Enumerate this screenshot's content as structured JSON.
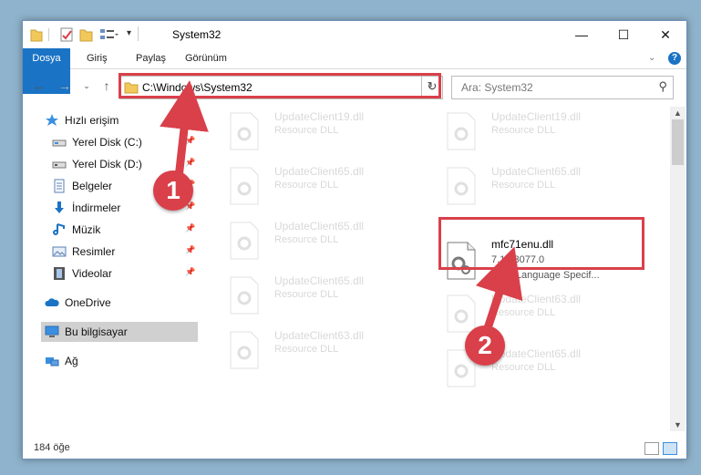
{
  "window": {
    "title": "System32",
    "controls": {
      "minimize": "—",
      "maximize": "☐",
      "close": "✕"
    }
  },
  "ribbon": {
    "tabs": [
      "Dosya",
      "Giriş",
      "Paylaş",
      "Görünüm"
    ]
  },
  "navbar": {
    "address": "C:\\Windows\\System32",
    "search_placeholder": "Ara: System32"
  },
  "sidebar": {
    "quick_access": "Hızlı erişim",
    "items": [
      "Yerel Disk (C:)",
      "Yerel Disk (D:)",
      "Belgeler",
      "İndirmeler",
      "Müzik",
      "Resimler",
      "Videolar"
    ],
    "onedrive": "OneDrive",
    "this_pc": "Bu bilgisayar",
    "network": "Ağ"
  },
  "files": {
    "left": [
      {
        "name": "UpdateClient19.dll",
        "desc": "Resource DLL"
      },
      {
        "name": "UpdateClient65.dll",
        "desc": "Resource DLL"
      },
      {
        "name": "UpdateClient65.dll",
        "desc": "Resource DLL"
      },
      {
        "name": "UpdateClient65.dll",
        "desc": "Resource DLL"
      },
      {
        "name": "UpdateClient63.dll",
        "desc": "Resource DLL"
      }
    ],
    "right": [
      {
        "name": "UpdateClient19.dll",
        "desc": "Resource DLL"
      },
      {
        "name": "UpdateClient65.dll",
        "desc": "Resource DLL"
      },
      {
        "name": "UpdateClient63.dll",
        "desc": "Resource DLL"
      },
      {
        "name": "UpdateClient65.dll",
        "desc": "Resource DLL"
      }
    ],
    "highlighted": {
      "name": "mfc71enu.dll",
      "version": "7.10.3077.0",
      "desc": "MFC Language Specif..."
    }
  },
  "status": {
    "count": "184 öğe"
  },
  "callouts": {
    "one": "1",
    "two": "2"
  },
  "colors": {
    "accent": "#1a73c4",
    "highlight": "#d9404a"
  }
}
